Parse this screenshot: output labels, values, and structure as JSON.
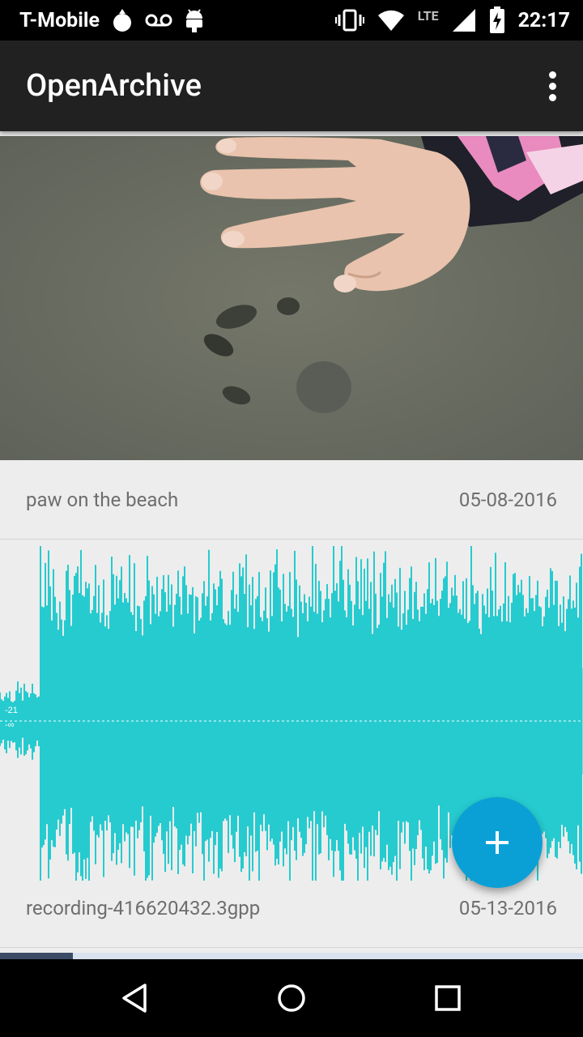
{
  "status_bar": {
    "carrier": "T-Mobile",
    "network": "LTE",
    "time": "22:17",
    "icons": [
      "notification-drop-icon",
      "voicemail-icon",
      "android-icon",
      "vibrate-icon",
      "wifi-icon",
      "signal-icon",
      "battery-charging-icon"
    ]
  },
  "app_bar": {
    "title": "OpenArchive",
    "overflow_icon": "more-vert-icon"
  },
  "media_list": [
    {
      "type": "image",
      "title": "paw on the beach",
      "date": "05-08-2016"
    },
    {
      "type": "audio",
      "title": "recording-416620432.3gpp",
      "date": "05-13-2016",
      "waveform_labels": [
        "-21",
        "-∞"
      ]
    }
  ],
  "fab": {
    "icon": "add-icon",
    "color": "#0aa0d6"
  },
  "nav_bar": {
    "buttons": [
      "back-icon",
      "home-icon",
      "recents-icon"
    ]
  },
  "colors": {
    "waveform": "#26cbcf",
    "app_bar": "#212121",
    "background": "#ededed"
  }
}
